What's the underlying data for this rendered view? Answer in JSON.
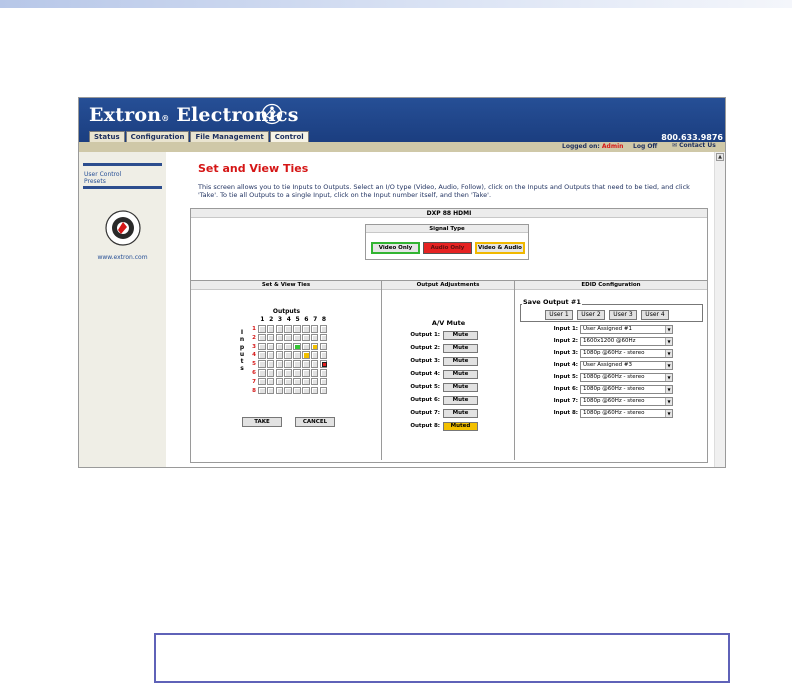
{
  "browser": {
    "brand": "Extron",
    "brand_suffix": "Electronics",
    "tabs": [
      "Status",
      "Configuration",
      "File Management",
      "Control"
    ],
    "active_tab": "Control",
    "phone": "800.633.9876",
    "logged_label": "Logged on:",
    "logged_user": "Admin",
    "logoff": "Log Off",
    "contact": "Contact Us"
  },
  "sidebar": {
    "links": [
      "User Control",
      "Presets"
    ],
    "url": "www.extron.com"
  },
  "page": {
    "title": "Set and View Ties",
    "description": "This screen allows you to tie Inputs to Outputs. Select an I/O type (Video, Audio, Follow), click on the Inputs and Outputs that need to be tied, and click 'Take'. To tie all Outputs to a single Input, click on the Input number itself, and then 'Take'.",
    "device": "DXP 88 HDMI"
  },
  "signal_type": {
    "title": "Signal Type",
    "buttons": [
      "Video Only",
      "Audio Only",
      "Video & Audio"
    ],
    "selected": "Audio Only"
  },
  "ties": {
    "title": "Set & View Ties",
    "outputs_label": "Outputs",
    "inputs_label": "Inputs",
    "columns": [
      "1",
      "2",
      "3",
      "4",
      "5",
      "6",
      "7",
      "8"
    ],
    "rows": [
      "1",
      "2",
      "3",
      "4",
      "5",
      "6",
      "7",
      "8"
    ],
    "tied_cells": [
      {
        "input": 3,
        "output": 5,
        "type": "video",
        "color": "#35c435"
      },
      {
        "input": 3,
        "output": 7,
        "type": "follow",
        "color": "#f3c000"
      },
      {
        "input": 4,
        "output": 6,
        "type": "follow",
        "color": "#f3c000"
      },
      {
        "input": 5,
        "output": 8,
        "type": "audio",
        "color": "#e52222"
      }
    ],
    "take": "TAKE",
    "cancel": "CANCEL"
  },
  "output_adjustments": {
    "title": "Output Adjustments",
    "header": "A/V Mute",
    "outputs": [
      {
        "label": "Output 1:",
        "button": "Mute",
        "muted": false
      },
      {
        "label": "Output 2:",
        "button": "Mute",
        "muted": false
      },
      {
        "label": "Output 3:",
        "button": "Mute",
        "muted": false
      },
      {
        "label": "Output 4:",
        "button": "Mute",
        "muted": false
      },
      {
        "label": "Output 5:",
        "button": "Mute",
        "muted": false
      },
      {
        "label": "Output 6:",
        "button": "Mute",
        "muted": false
      },
      {
        "label": "Output 7:",
        "button": "Mute",
        "muted": false
      },
      {
        "label": "Output 8:",
        "button": "Muted",
        "muted": true
      }
    ]
  },
  "edid": {
    "title": "EDID Configuration",
    "save_legend": "Save Output #1",
    "user_buttons": [
      "User 1",
      "User 2",
      "User 3",
      "User 4"
    ],
    "inputs": [
      {
        "label": "Input 1:",
        "value": "User Assigned #1"
      },
      {
        "label": "Input 2:",
        "value": "1600x1200 @60Hz"
      },
      {
        "label": "Input 3:",
        "value": "1080p @60Hz - stereo"
      },
      {
        "label": "Input 4:",
        "value": "User Assigned #3"
      },
      {
        "label": "Input 5:",
        "value": "1080p @60Hz - stereo"
      },
      {
        "label": "Input 6:",
        "value": "1080p @60Hz - stereo"
      },
      {
        "label": "Input 7:",
        "value": "1080p @60Hz - stereo"
      },
      {
        "label": "Input 8:",
        "value": "1080p @60Hz - stereo"
      }
    ]
  },
  "colors": {
    "banner": "#1b3e80",
    "title_red": "#d51616",
    "video": "#35c435",
    "audio": "#e52222",
    "follow": "#f3c000",
    "note_border": "#5f62b8"
  }
}
